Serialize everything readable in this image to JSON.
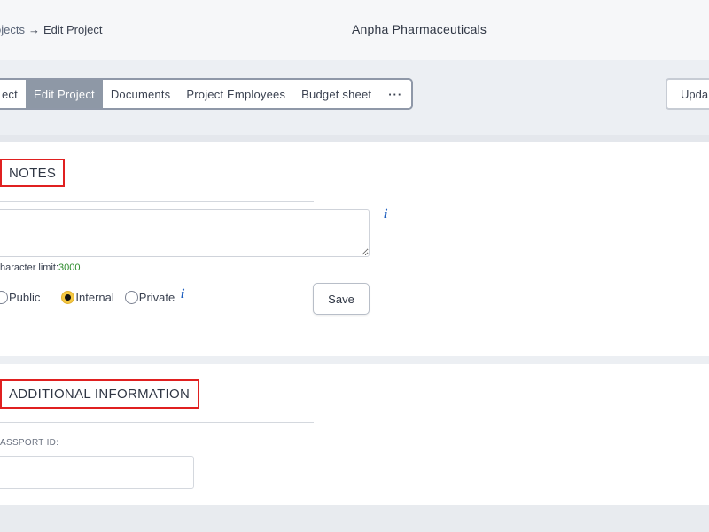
{
  "header": {
    "breadcrumb_parent": "ojects",
    "breadcrumb_arrow": "→",
    "breadcrumb_current": "Edit Project",
    "company": "Anpha Pharmaceuticals"
  },
  "tabs": [
    {
      "label": "ect"
    },
    {
      "label": "Edit Project"
    },
    {
      "label": "Documents"
    },
    {
      "label": "Project Employees"
    },
    {
      "label": "Budget sheet"
    },
    {
      "label": "···"
    }
  ],
  "update_button": "Upda",
  "notes": {
    "title": "NOTES",
    "textarea_value": "",
    "char_limit_label": "haracter limit:",
    "char_limit_value": "3000",
    "radio_public": "Public",
    "radio_internal": "Internal",
    "radio_private": "Private",
    "save_label": "Save",
    "info_icon": "i"
  },
  "additional": {
    "title": "ADDITIONAL INFORMATION",
    "passport_label": "ASSPORT ID:",
    "passport_value": ""
  },
  "colors": {
    "active_tab": "#8e98a6",
    "highlight_border": "#e02020",
    "info_icon": "#1f5fbf",
    "char_limit_number": "#2a8a2a",
    "radio_checked": "#f5c842"
  }
}
